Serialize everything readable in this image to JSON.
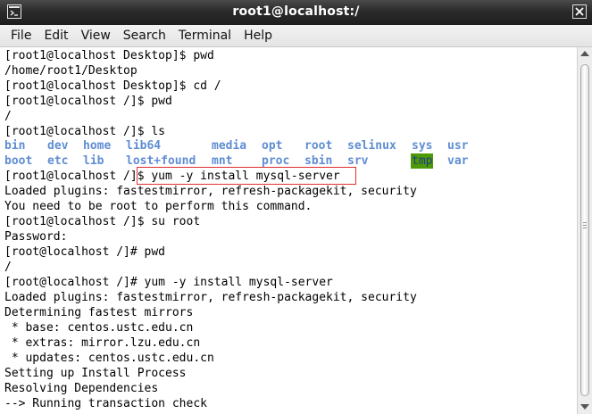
{
  "window": {
    "title": "root1@localhost:/",
    "app_icon": "terminal-icon",
    "close_icon": "close-icon"
  },
  "menu": [
    "File",
    "Edit",
    "View",
    "Search",
    "Terminal",
    "Help"
  ],
  "lines_before": [
    "[root1@localhost Desktop]$ pwd",
    "/home/root1/Desktop",
    "[root1@localhost Desktop]$ cd /",
    "[root1@localhost /]$ pwd",
    "/",
    "[root1@localhost /]$ ls"
  ],
  "ls": {
    "row1": [
      "bin",
      "dev",
      "home",
      "lib64",
      "media",
      "opt",
      "root",
      "selinux",
      "sys",
      "usr"
    ],
    "row2": [
      "boot",
      "etc",
      "lib",
      "lost+found",
      "mnt",
      "proc",
      "sbin",
      "srv",
      "tmp",
      "var"
    ],
    "dir_color": "#5f8dd3",
    "highlight_bg": "#4e9a06"
  },
  "lines_after": [
    "[root1@localhost /]$ yum -y install mysql-server",
    "Loaded plugins: fastestmirror, refresh-packagekit, security",
    "You need to be root to perform this command.",
    "[root1@localhost /]$ su root",
    "Password:",
    "[root@localhost /]# pwd",
    "/",
    "[root@localhost /]# yum -y install mysql-server",
    "Loaded plugins: fastestmirror, refresh-packagekit, security",
    "Determining fastest mirrors",
    " * base: centos.ustc.edu.cn",
    " * extras: mirror.lzu.edu.cn",
    " * updates: centos.ustc.edu.cn",
    "Setting up Install Process",
    "Resolving Dependencies",
    "--> Running transaction check"
  ],
  "annotation_color": "#e03030"
}
